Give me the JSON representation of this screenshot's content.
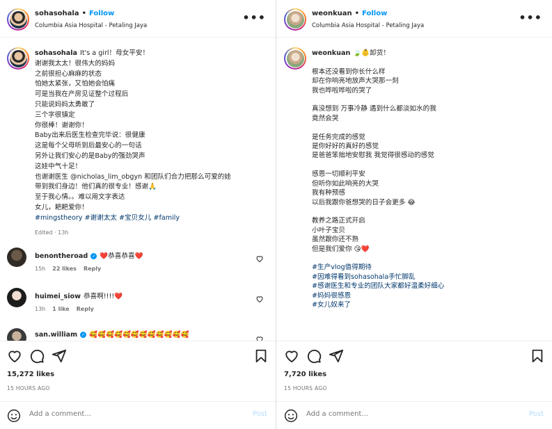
{
  "colors": {
    "accent": "#0095f6",
    "heart": "#ed4956",
    "muted": "#737373",
    "hashtag": "#00376b"
  },
  "left": {
    "header": {
      "username": "sohasohala",
      "dot": "•",
      "follow": "Follow",
      "location": "Columbia Asia Hospital - Petaling Jaya",
      "more": "•••"
    },
    "caption": {
      "username": "sohasohala",
      "lines": [
        "It's a girl！母女平安！",
        "谢谢我太太！很伟大的妈妈",
        "之前很担心麻麻的状态",
        "怕她太紧张，又怕她会怕痛",
        "可是当我在产房见证整个过程后",
        "只能说妈妈太勇敢了",
        "三个字很镇定",
        "你很棒！谢谢你！",
        "Baby出来后医生检查完毕说：很健康",
        "这是每个父母听到后最安心的一句话",
        "另外让我们安心的是Baby的强劲哭声",
        "这娃中气十足！",
        "也谢谢医生 @nicholas_lim_obgyn 和团队们合力把那么可爱的娃",
        "带到我们身边！他们真的很专业！感谢🙏",
        "至于我心情。。难以用文字表达",
        "女儿，耙耙爱你！"
      ],
      "hashtags": "#mingstheory #谢谢太太 #宝贝女儿 #family",
      "edited": "Edited · 13h"
    },
    "comments": [
      {
        "username": "benontheroad",
        "verified": true,
        "text": "❤️恭喜恭喜❤️",
        "time": "15h",
        "likes": "22 likes",
        "reply": "Reply"
      },
      {
        "username": "huimei_siow",
        "verified": false,
        "text": "恭喜啊!!!!❤️",
        "time": "13h",
        "likes": "1 like",
        "reply": "Reply"
      },
      {
        "username": "san.william",
        "verified": true,
        "text": "🥰🥰🥰🥰🥰🥰🥰🥰🥰🥰🥰🥰",
        "time": "",
        "likes": "",
        "reply": ""
      }
    ],
    "likes": "15,272 likes",
    "time": "15 HOURS AGO",
    "add_comment_placeholder": "Add a comment...",
    "post_label": "Post"
  },
  "right": {
    "header": {
      "username": "weonkuan",
      "dot": "•",
      "follow": "Follow",
      "location": "Columbia Asia Hospital - Petaling Jaya",
      "more": "•••"
    },
    "caption": {
      "username": "weonkuan",
      "first_line": "🍃👶卸货！",
      "lines": [
        "",
        "根本还没看到你长什么样",
        "却在你响亮地放声大哭那一刻",
        "我也哗啦哗啦的哭了",
        "",
        "真没想到 万事冷静 遇到什么都淡如水的我",
        "竟然会哭",
        "",
        "是任务完成的感觉",
        "是你好好的真好的感觉",
        "是爸爸笨拙地安慰我 我觉得很感动的感觉",
        "",
        "感恩一切顺利平安",
        "但听你如此响亮的大哭",
        "我有种预感",
        "以后我跟你爸想哭的日子会更多 😂",
        "",
        "教养之路正式开启",
        "小叶子宝贝",
        "虽然跟你还不熟",
        "但是我们爱你 😘❤️",
        ""
      ],
      "hashtags": [
        "#生产vlog值得期待",
        "#因难得看到sohasohala手忙脚乱",
        "#感谢医生和专业的团队大家都好温柔好细心",
        "#妈妈很感恩",
        "#女儿奴来了"
      ]
    },
    "likes": "7,720 likes",
    "time": "15 HOURS AGO",
    "add_comment_placeholder": "Add a comment...",
    "post_label": "Post"
  }
}
